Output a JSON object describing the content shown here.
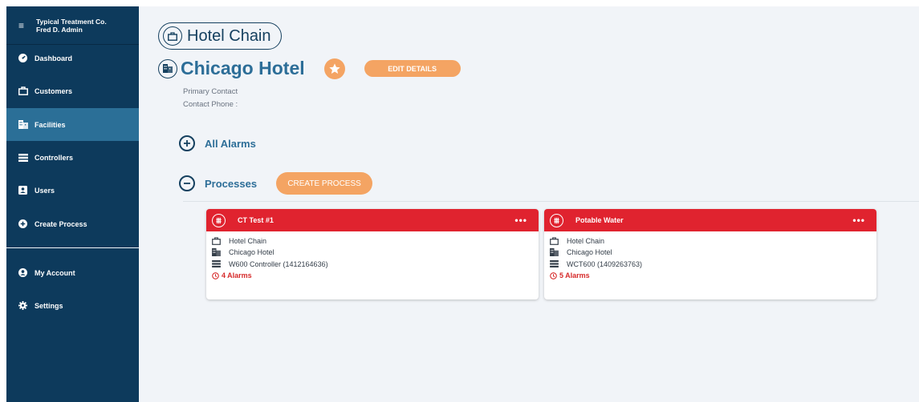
{
  "sidebar": {
    "org_name": "Typical Treatment Co.",
    "user_name": "Fred D. Admin",
    "items": [
      {
        "label": "Dashboard",
        "icon": "dashboard-icon"
      },
      {
        "label": "Customers",
        "icon": "briefcase-icon"
      },
      {
        "label": "Facilities",
        "icon": "building-icon",
        "active": true
      },
      {
        "label": "Controllers",
        "icon": "list-icon"
      },
      {
        "label": "Users",
        "icon": "user-card-icon"
      },
      {
        "label": "Create Process",
        "icon": "plus-circle-icon"
      }
    ],
    "bottom_items": [
      {
        "label": "My Account",
        "icon": "account-icon"
      },
      {
        "label": "Settings",
        "icon": "gear-icon"
      }
    ]
  },
  "header": {
    "chain": "Hotel Chain",
    "hotel": "Chicago Hotel",
    "edit_label": "EDIT DETAILS",
    "primary_contact": "Primary Contact",
    "contact_phone": "Contact Phone :"
  },
  "sections": {
    "alarms": "All Alarms",
    "processes": "Processes",
    "create_process_label": "CREATE PROCESS"
  },
  "processes": [
    {
      "name": "CT Test #1",
      "chain": "Hotel Chain",
      "facility": "Chicago Hotel",
      "controller": "W600 Controller (1412164636)",
      "alarms": "4 Alarms"
    },
    {
      "name": "Potable Water",
      "chain": "Hotel Chain",
      "facility": "Chicago Hotel",
      "controller": "WCT600 (1409263763)",
      "alarms": "5 Alarms"
    }
  ],
  "colors": {
    "sidebar": "#0d3a5c",
    "active": "#2b6f97",
    "accent": "#f4a463",
    "card_header": "#e0232f",
    "title": "#2d6e98"
  }
}
